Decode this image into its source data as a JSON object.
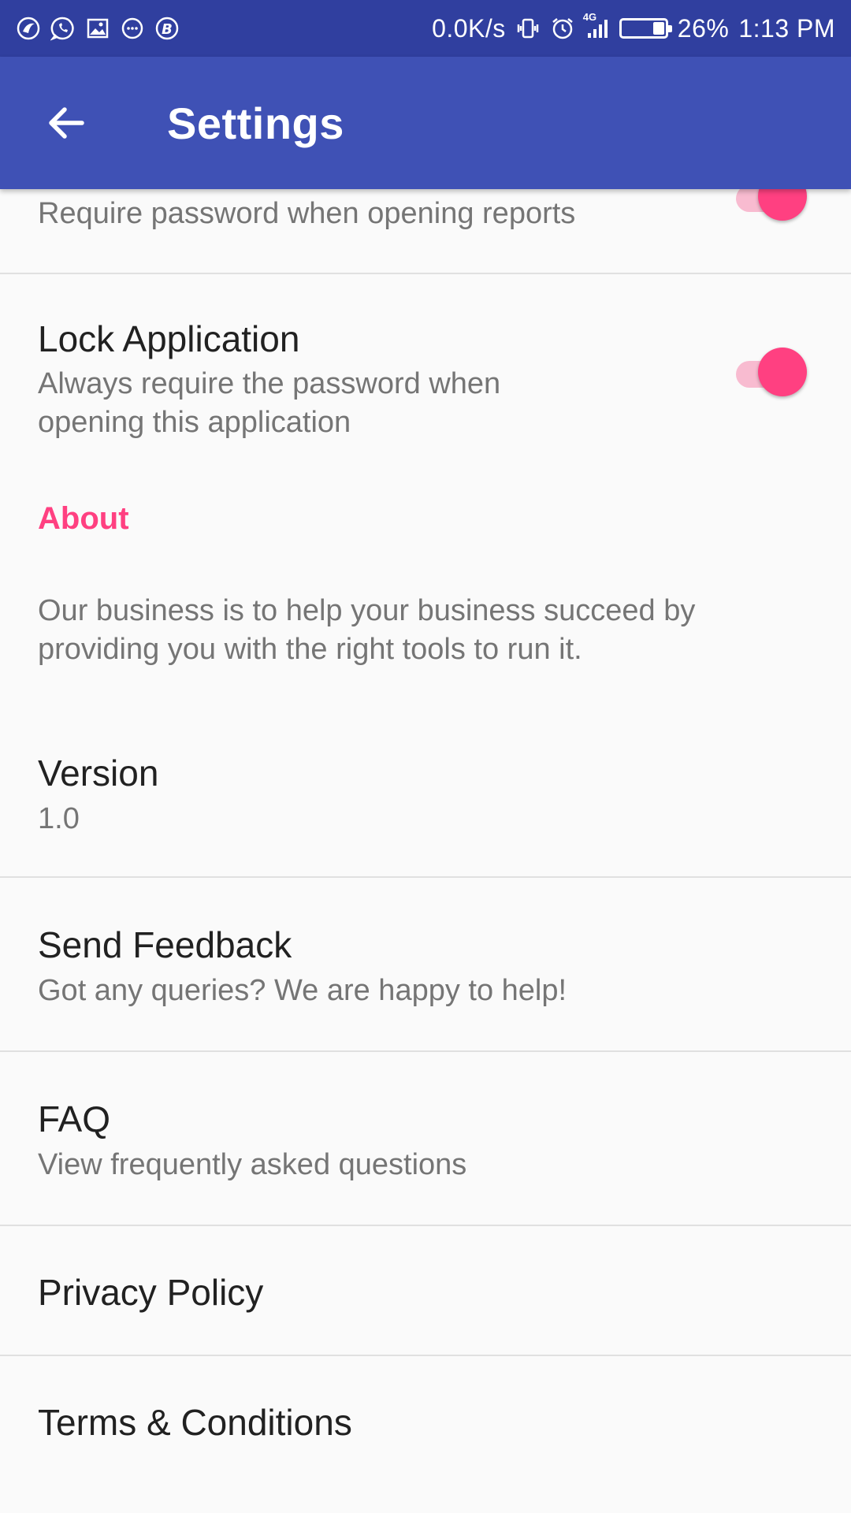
{
  "status_bar": {
    "net_speed": "0.0K/s",
    "network_type": "4G",
    "battery": "26%",
    "battery_level": 0.26,
    "time": "1:13 PM",
    "left_icons": [
      "app-notification-icon",
      "whatsapp-icon",
      "gallery-icon",
      "message-icon",
      "b-app-icon"
    ],
    "right_icons": [
      "vibrate-icon",
      "alarm-icon",
      "signal-icon",
      "battery-icon"
    ]
  },
  "app_bar": {
    "title": "Settings",
    "back_icon": "back-arrow-icon"
  },
  "settings": {
    "report_password": {
      "summary": "Require password when opening reports",
      "enabled": true
    },
    "lock_application": {
      "title": "Lock Application",
      "summary_line1": "Always require the password when",
      "summary_line2": "opening this application",
      "enabled": true
    },
    "about_header": "About",
    "about_text_line1": "Our business is to help your business succeed by",
    "about_text_line2": "providing you with the right tools to run it.",
    "version": {
      "title": "Version",
      "value": "1.0"
    },
    "send_feedback": {
      "title": "Send Feedback",
      "summary": "Got any queries? We are happy to help!"
    },
    "faq": {
      "title": "FAQ",
      "summary": "View frequently asked questions"
    },
    "privacy_policy": {
      "title": "Privacy Policy"
    },
    "terms": {
      "title": "Terms & Conditions"
    }
  },
  "colors": {
    "status_bar": "#303f9f",
    "app_bar": "#3f51b5",
    "accent": "#ff4081",
    "switch_track": "#f8bbd0",
    "background": "#fafafa",
    "divider": "#e0e0e0"
  }
}
